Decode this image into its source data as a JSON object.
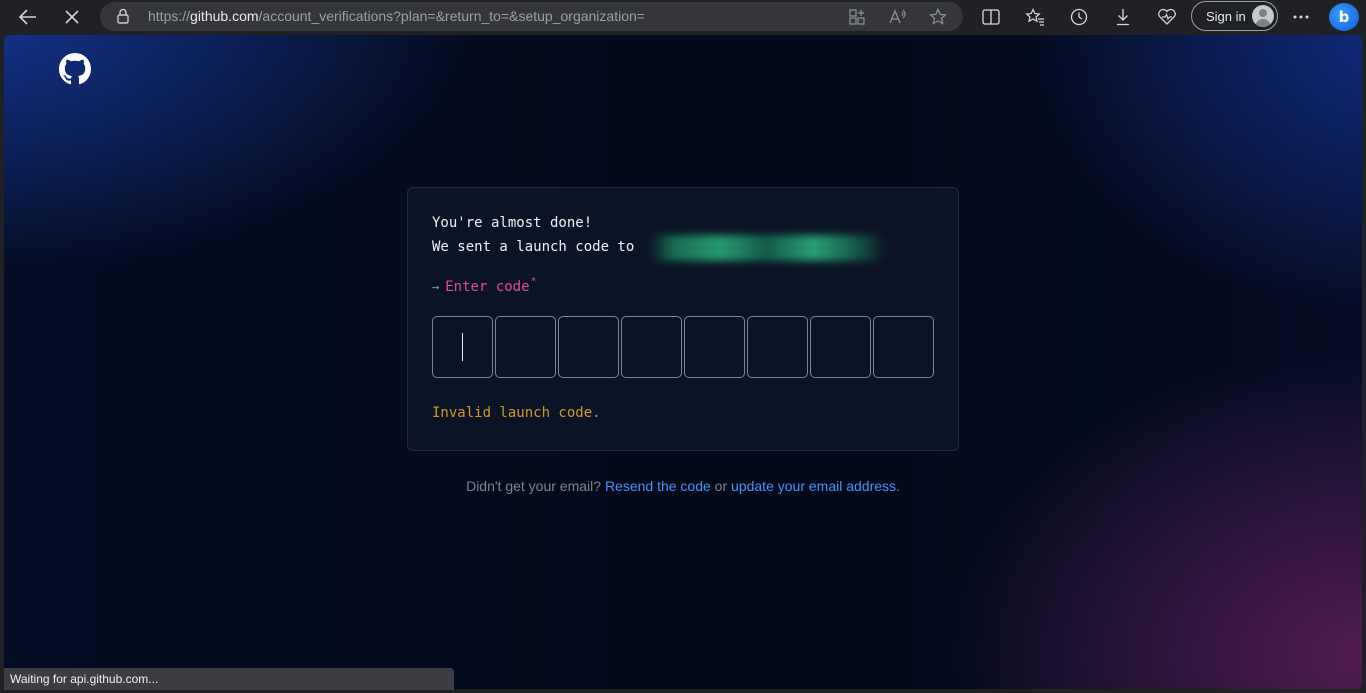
{
  "browser": {
    "url_prefix": "https://",
    "url_host": "github.com",
    "url_path": "/account_verifications?plan=&return_to=&setup_organization=",
    "signin_label": "Sign in",
    "icons": [
      "back-arrow-icon",
      "stop-icon",
      "lock-icon",
      "app-available-icon",
      "read-aloud-icon",
      "favorite-star-icon",
      "split-screen-icon",
      "favorites-icon",
      "history-icon",
      "downloads-icon",
      "browser-essentials-icon",
      "more-icon",
      "bing-icon"
    ]
  },
  "page": {
    "line1": "You're almost done!",
    "line2": "We sent a launch code to",
    "enter_arrow": "→",
    "enter_label": "Enter code",
    "required_mark": "*",
    "code_box_count": 8,
    "error": "Invalid launch code.",
    "footer_prefix": "Didn't get your email? ",
    "resend_link": "Resend the code",
    "footer_or": " or ",
    "update_link": "update your email address",
    "footer_suffix": "."
  },
  "status_bar": "Waiting for api.github.com...",
  "colors": {
    "accent_pink": "#e8499a",
    "error_amber": "#d29922",
    "link_blue": "#4493f8"
  }
}
